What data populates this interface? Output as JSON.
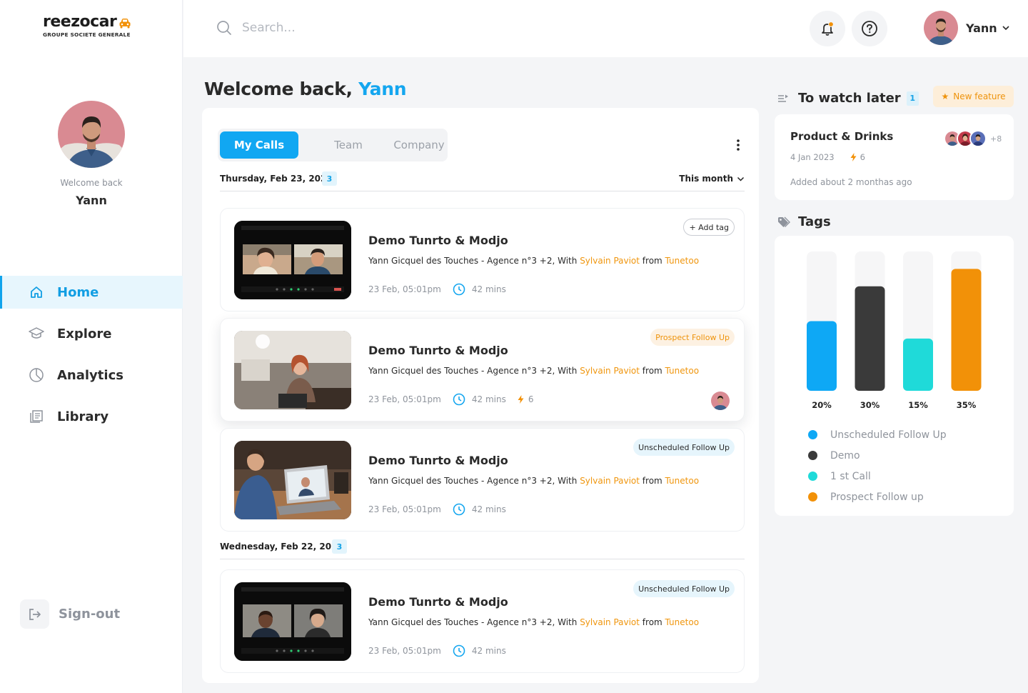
{
  "brand": {
    "name": "reezocar",
    "subtitle": "GROUPE SOCIETE GENERALE"
  },
  "profile": {
    "welcome": "Welcome back",
    "name": "Yann"
  },
  "nav": [
    {
      "label": "Home",
      "icon": "home-icon",
      "active": true
    },
    {
      "label": "Explore",
      "icon": "graduation-cap-icon",
      "active": false
    },
    {
      "label": "Analytics",
      "icon": "pie-chart-icon",
      "active": false
    },
    {
      "label": "Library",
      "icon": "library-icon",
      "active": false
    }
  ],
  "signout": {
    "label": "Sign-out"
  },
  "header": {
    "search_placeholder": "Search...",
    "user_name": "Yann"
  },
  "welcome": {
    "prefix": "Welcome back, ",
    "name": "Yann"
  },
  "calls": {
    "tabs": [
      "My Calls",
      "Team",
      "Company"
    ],
    "active_tab": "My Calls",
    "filter_label": "This month",
    "groups": [
      {
        "date": "Thursday, Feb 23, 2023",
        "count": "3"
      },
      {
        "date": "Wednesday, Feb 22, 2023",
        "count": "3"
      }
    ],
    "items": [
      {
        "title": "Demo Tunrto & Modjo",
        "desc_prefix": "Yann Gicquel des Touches - Agence n°3 +2, With ",
        "contact": "Sylvain Paviot",
        "desc_from": " from ",
        "company": "Tunetoo",
        "datetime": "23 Feb, 05:01pm",
        "duration": "42 mins",
        "tag": "+ Add tag",
        "tag_type": "add"
      },
      {
        "title": "Demo Tunrto & Modjo",
        "desc_prefix": "Yann Gicquel des Touches - Agence n°3 +2, With ",
        "contact": "Sylvain Paviot",
        "desc_from": " from ",
        "company": "Tunetoo",
        "datetime": "23 Feb, 05:01pm",
        "duration": "42 mins",
        "bolt_count": "6",
        "tag": "Prospect Follow Up",
        "tag_type": "prospect"
      },
      {
        "title": "Demo Tunrto & Modjo",
        "desc_prefix": "Yann Gicquel des Touches - Agence n°3 +2, With ",
        "contact": "Sylvain Paviot",
        "desc_from": " from ",
        "company": "Tunetoo",
        "datetime": "23 Feb, 05:01pm",
        "duration": "42 mins",
        "tag": "Unscheduled Follow Up",
        "tag_type": "unsched"
      },
      {
        "title": "Demo Tunrto & Modjo",
        "desc_prefix": "Yann Gicquel des Touches - Agence n°3 +2, With ",
        "contact": "Sylvain Paviot",
        "desc_from": " from ",
        "company": "Tunetoo",
        "datetime": "23 Feb, 05:01pm",
        "duration": "42 mins",
        "tag": "Unscheduled Follow Up",
        "tag_type": "unsched"
      }
    ]
  },
  "watch_later": {
    "title": "To watch later",
    "count": "1",
    "new_feature": "New feature",
    "card": {
      "title": "Product & Drinks",
      "date": "4 Jan 2023",
      "bolt_count": "6",
      "added": "Added about 2 monthas ago",
      "more_avatars": "+8"
    }
  },
  "tags": {
    "title": "Tags"
  },
  "chart_data": {
    "type": "bar",
    "categories": [
      "Unscheduled Follow Up",
      "Demo",
      "1 st Call",
      "Prospect Follow up"
    ],
    "values": [
      20,
      30,
      15,
      35
    ],
    "value_labels": [
      "20%",
      "30%",
      "15%",
      "35%"
    ],
    "colors": [
      "#0ea8f5",
      "#3a3a3a",
      "#1fdad9",
      "#f29108"
    ],
    "ylim": [
      0,
      40
    ],
    "legend": [
      "Unscheduled Follow Up",
      "Demo",
      "1 st Call",
      "Prospect Follow up"
    ],
    "legend_placement": "bottom"
  },
  "colors": {
    "accent": "#11a7f2",
    "orange": "#f0960e"
  }
}
